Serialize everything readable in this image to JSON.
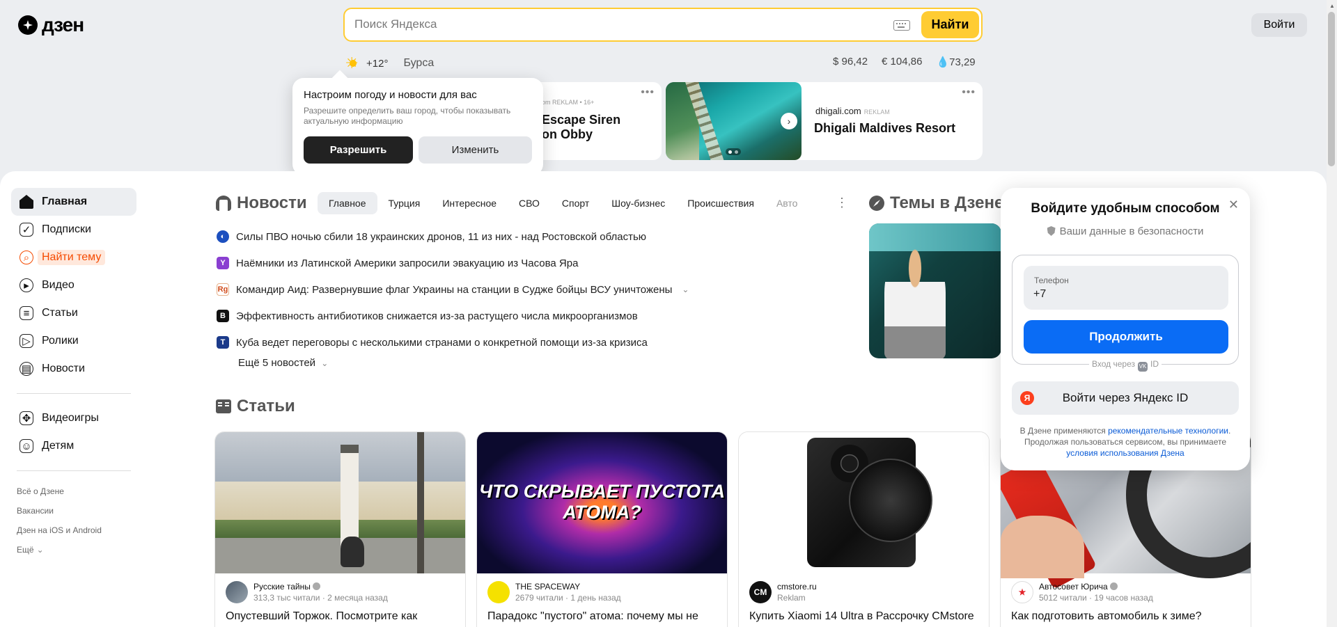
{
  "header": {
    "logo_text": "дзен",
    "search_placeholder": "Поиск Яндекса",
    "search_button": "Найти",
    "login_button": "Войти"
  },
  "weather": {
    "temp": "+12°",
    "city": "Бурса",
    "icon": "sun-icon"
  },
  "rates": {
    "usd": "$ 96,42",
    "eur": "€ 104,86",
    "oil": "💧73,29"
  },
  "ads": [
    {
      "meta": "om REKLAM • 16+",
      "title_line1": "Escape Siren",
      "title_line2": "on Obby"
    },
    {
      "source": "dhigali.com",
      "tag": "REKLAM",
      "title": "Dhigali Maldives Resort"
    }
  ],
  "weather_popup": {
    "title": "Настроим погоду и новости для вас",
    "text": "Разрешите определить ваш город, чтобы показывать актуальную информацию",
    "allow": "Разрешить",
    "change": "Изменить"
  },
  "sidebar": {
    "items": [
      {
        "label": "Главная",
        "icon": "home-icon"
      },
      {
        "label": "Подписки",
        "icon": "subscriptions-icon"
      },
      {
        "label": "Найти тему",
        "icon": "find-topic-icon"
      },
      {
        "label": "Видео",
        "icon": "video-icon"
      },
      {
        "label": "Статьи",
        "icon": "articles-icon"
      },
      {
        "label": "Ролики",
        "icon": "clips-icon"
      },
      {
        "label": "Новости",
        "icon": "news-icon"
      },
      {
        "label": "Видеоигры",
        "icon": "gamepad-icon"
      },
      {
        "label": "Детям",
        "icon": "kids-icon"
      }
    ],
    "links": [
      "Всё о Дзене",
      "Вакансии",
      "Дзен на iOS и Android",
      "Ещё"
    ]
  },
  "news": {
    "title": "Новости",
    "tabs": [
      "Главное",
      "Турция",
      "Интересное",
      "СВО",
      "Спорт",
      "Шоу-бизнес",
      "Происшествия",
      "Авто"
    ],
    "items": [
      "Силы ПВО ночью сбили 18 украинских дронов, 11 из них - над Ростовской областью",
      "Наёмники из Латинской Америки запросили эвакуацию из Часова Яра",
      "Командир Аид: Развернувшие флаг Украины на станции в Судже бойцы ВСУ уничтожены",
      "Эффективность антибиотиков снижается из-за растущего числа микроорганизмов",
      "Куба ведет переговоры с несколькими странами о конкретной помощи из-за кризиса"
    ],
    "more": "Ещё 5 новостей"
  },
  "topics": {
    "title": "Темы в Дзене"
  },
  "login_modal": {
    "title": "Войдите удобным способом",
    "safety": "Ваши данные в безопасности",
    "phone_label": "Телефон",
    "phone_value": "+7",
    "continue": "Продолжить",
    "via": "Вход через",
    "via_id": "ID",
    "yandex_button": "Войти через Яндекс ID",
    "foot_1": "В Дзене применяются ",
    "foot_link1": "рекомендательные технологии",
    "foot_2": ". Продолжая пользоваться сервисом, вы принимаете ",
    "foot_link2": "условия использования Дзена"
  },
  "articles": {
    "title": "Статьи",
    "cards": [
      {
        "author": "Русские тайны",
        "sub": "313,3 тыс читали · 2 месяца назад",
        "title": "Опустевший Торжок. Посмотрите как",
        "avatar": ""
      },
      {
        "author": "THE SPACEWAY",
        "sub": "2679 читали · 1 день назад",
        "title": "Парадокс \"пустого\" атома: почему мы не",
        "image_text": "ЧТО СКРЫВАЕТ ПУСТОТА АТОМА?",
        "avatar": ""
      },
      {
        "author": "cmstore.ru",
        "sub": "Reklam",
        "title": "Купить Xiaomi 14 Ultra в Рассрочку CMstore",
        "avatar": "CM"
      },
      {
        "author": "Автосовет Юрича",
        "sub": "5012 читали · 19 часов назад",
        "title": "Как подготовить автомобиль к зиме?",
        "avatar": "★"
      }
    ]
  }
}
